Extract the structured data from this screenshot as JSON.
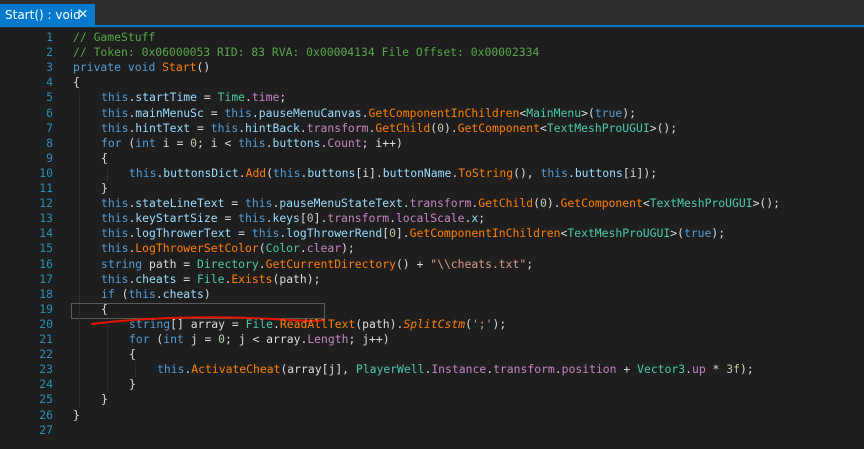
{
  "tab": {
    "title": "Start() : void",
    "close_label": "✕"
  },
  "colors": {
    "accent": "#007acc",
    "background": "#1e1e1e",
    "line_number": "#2b91af",
    "keyword": "#569cd6",
    "type": "#4ec9b0",
    "method": "#ff8000",
    "comment": "#57a64a",
    "string": "#d69d85",
    "underline_mark": "#e51400"
  },
  "code_lines": [
    {
      "n": "1",
      "indent": 0,
      "tokens": [
        [
          "// GameStuff",
          "comment"
        ]
      ]
    },
    {
      "n": "2",
      "indent": 0,
      "tokens": [
        [
          "// Token: 0x06000053 RID: 83 RVA: 0x00004134 File Offset: 0x00002334",
          "comment"
        ]
      ]
    },
    {
      "n": "3",
      "indent": 0,
      "tokens": [
        [
          "private",
          "kw"
        ],
        [
          " ",
          "plain"
        ],
        [
          "void",
          "kw"
        ],
        [
          " ",
          "plain"
        ],
        [
          "Start",
          "method"
        ],
        [
          "()",
          "plain"
        ]
      ]
    },
    {
      "n": "4",
      "indent": 0,
      "tokens": [
        [
          "{",
          "plain"
        ]
      ]
    },
    {
      "n": "5",
      "indent": 1,
      "tokens": [
        [
          "this",
          "kw"
        ],
        [
          ".",
          "plain"
        ],
        [
          "startTime",
          "field"
        ],
        [
          " = ",
          "plain"
        ],
        [
          "Time",
          "type"
        ],
        [
          ".",
          "plain"
        ],
        [
          "time",
          "prop"
        ],
        [
          ";",
          "plain"
        ]
      ]
    },
    {
      "n": "6",
      "indent": 1,
      "tokens": [
        [
          "this",
          "kw"
        ],
        [
          ".",
          "plain"
        ],
        [
          "mainMenuSc",
          "field"
        ],
        [
          " = ",
          "plain"
        ],
        [
          "this",
          "kw"
        ],
        [
          ".",
          "plain"
        ],
        [
          "pauseMenuCanvas",
          "field"
        ],
        [
          ".",
          "plain"
        ],
        [
          "GetComponentInChildren",
          "method"
        ],
        [
          "<",
          "plain"
        ],
        [
          "MainMenu",
          "type"
        ],
        [
          ">(",
          "plain"
        ],
        [
          "true",
          "kw"
        ],
        [
          ");",
          "plain"
        ]
      ]
    },
    {
      "n": "7",
      "indent": 1,
      "tokens": [
        [
          "this",
          "kw"
        ],
        [
          ".",
          "plain"
        ],
        [
          "hintText",
          "field"
        ],
        [
          " = ",
          "plain"
        ],
        [
          "this",
          "kw"
        ],
        [
          ".",
          "plain"
        ],
        [
          "hintBack",
          "field"
        ],
        [
          ".",
          "plain"
        ],
        [
          "transform",
          "prop"
        ],
        [
          ".",
          "plain"
        ],
        [
          "GetChild",
          "method"
        ],
        [
          "(",
          "plain"
        ],
        [
          "0",
          "num"
        ],
        [
          ").",
          "plain"
        ],
        [
          "GetComponent",
          "method"
        ],
        [
          "<",
          "plain"
        ],
        [
          "TextMeshProUGUI",
          "type"
        ],
        [
          ">();",
          "plain"
        ]
      ]
    },
    {
      "n": "8",
      "indent": 1,
      "tokens": [
        [
          "for",
          "kw"
        ],
        [
          " (",
          "plain"
        ],
        [
          "int",
          "kw"
        ],
        [
          " i = ",
          "plain"
        ],
        [
          "0",
          "num"
        ],
        [
          "; i < ",
          "plain"
        ],
        [
          "this",
          "kw"
        ],
        [
          ".",
          "plain"
        ],
        [
          "buttons",
          "field"
        ],
        [
          ".",
          "plain"
        ],
        [
          "Count",
          "prop"
        ],
        [
          "; i++)",
          "plain"
        ]
      ]
    },
    {
      "n": "9",
      "indent": 1,
      "tokens": [
        [
          "{",
          "plain"
        ]
      ]
    },
    {
      "n": "10",
      "indent": 2,
      "tokens": [
        [
          "this",
          "kw"
        ],
        [
          ".",
          "plain"
        ],
        [
          "buttonsDict",
          "field"
        ],
        [
          ".",
          "plain"
        ],
        [
          "Add",
          "method"
        ],
        [
          "(",
          "plain"
        ],
        [
          "this",
          "kw"
        ],
        [
          ".",
          "plain"
        ],
        [
          "buttons",
          "field"
        ],
        [
          "[i].",
          "plain"
        ],
        [
          "buttonName",
          "field"
        ],
        [
          ".",
          "plain"
        ],
        [
          "ToString",
          "method"
        ],
        [
          "(), ",
          "plain"
        ],
        [
          "this",
          "kw"
        ],
        [
          ".",
          "plain"
        ],
        [
          "buttons",
          "field"
        ],
        [
          "[i]);",
          "plain"
        ]
      ]
    },
    {
      "n": "11",
      "indent": 1,
      "tokens": [
        [
          "}",
          "plain"
        ]
      ]
    },
    {
      "n": "12",
      "indent": 1,
      "tokens": [
        [
          "this",
          "kw"
        ],
        [
          ".",
          "plain"
        ],
        [
          "stateLineText",
          "field"
        ],
        [
          " = ",
          "plain"
        ],
        [
          "this",
          "kw"
        ],
        [
          ".",
          "plain"
        ],
        [
          "pauseMenuStateText",
          "field"
        ],
        [
          ".",
          "plain"
        ],
        [
          "transform",
          "prop"
        ],
        [
          ".",
          "plain"
        ],
        [
          "GetChild",
          "method"
        ],
        [
          "(",
          "plain"
        ],
        [
          "0",
          "num"
        ],
        [
          ").",
          "plain"
        ],
        [
          "GetComponent",
          "method"
        ],
        [
          "<",
          "plain"
        ],
        [
          "TextMeshProUGUI",
          "type"
        ],
        [
          ">();",
          "plain"
        ]
      ]
    },
    {
      "n": "13",
      "indent": 1,
      "tokens": [
        [
          "this",
          "kw"
        ],
        [
          ".",
          "plain"
        ],
        [
          "keyStartSize",
          "field"
        ],
        [
          " = ",
          "plain"
        ],
        [
          "this",
          "kw"
        ],
        [
          ".",
          "plain"
        ],
        [
          "keys",
          "field"
        ],
        [
          "[",
          "plain"
        ],
        [
          "0",
          "num"
        ],
        [
          "].",
          "plain"
        ],
        [
          "transform",
          "prop"
        ],
        [
          ".",
          "plain"
        ],
        [
          "localScale",
          "prop"
        ],
        [
          ".",
          "plain"
        ],
        [
          "x",
          "field"
        ],
        [
          ";",
          "plain"
        ]
      ]
    },
    {
      "n": "14",
      "indent": 1,
      "tokens": [
        [
          "this",
          "kw"
        ],
        [
          ".",
          "plain"
        ],
        [
          "logThrowerText",
          "field"
        ],
        [
          " = ",
          "plain"
        ],
        [
          "this",
          "kw"
        ],
        [
          ".",
          "plain"
        ],
        [
          "logThrowerRend",
          "field"
        ],
        [
          "[",
          "plain"
        ],
        [
          "0",
          "num"
        ],
        [
          "].",
          "plain"
        ],
        [
          "GetComponentInChildren",
          "method"
        ],
        [
          "<",
          "plain"
        ],
        [
          "TextMeshProUGUI",
          "type"
        ],
        [
          ">(",
          "plain"
        ],
        [
          "true",
          "kw"
        ],
        [
          ");",
          "plain"
        ]
      ]
    },
    {
      "n": "15",
      "indent": 1,
      "tokens": [
        [
          "this",
          "kw"
        ],
        [
          ".",
          "plain"
        ],
        [
          "LogThrowerSetColor",
          "method"
        ],
        [
          "(",
          "plain"
        ],
        [
          "Color",
          "type"
        ],
        [
          ".",
          "plain"
        ],
        [
          "clear",
          "prop"
        ],
        [
          ");",
          "plain"
        ]
      ]
    },
    {
      "n": "16",
      "indent": 1,
      "tokens": [
        [
          "string",
          "kw"
        ],
        [
          " path = ",
          "plain"
        ],
        [
          "Directory",
          "type"
        ],
        [
          ".",
          "plain"
        ],
        [
          "GetCurrentDirectory",
          "method"
        ],
        [
          "() + ",
          "plain"
        ],
        [
          "\"\\\\cheats.txt\"",
          "str"
        ],
        [
          ";",
          "plain"
        ]
      ]
    },
    {
      "n": "17",
      "indent": 1,
      "tokens": [
        [
          "this",
          "kw"
        ],
        [
          ".",
          "plain"
        ],
        [
          "cheats",
          "field"
        ],
        [
          " = ",
          "plain"
        ],
        [
          "File",
          "type"
        ],
        [
          ".",
          "plain"
        ],
        [
          "Exists",
          "method"
        ],
        [
          "(path);",
          "plain"
        ]
      ]
    },
    {
      "n": "18",
      "indent": 1,
      "tokens": [
        [
          "if",
          "kw"
        ],
        [
          " (",
          "plain"
        ],
        [
          "this",
          "kw"
        ],
        [
          ".",
          "plain"
        ],
        [
          "cheats",
          "field"
        ],
        [
          ")",
          "plain"
        ]
      ]
    },
    {
      "n": "19",
      "indent": 1,
      "tokens": [
        [
          "{",
          "plain"
        ]
      ]
    },
    {
      "n": "20",
      "indent": 2,
      "tokens": [
        [
          "string",
          "kw"
        ],
        [
          "[] array = ",
          "plain"
        ],
        [
          "File",
          "type"
        ],
        [
          ".",
          "plain"
        ],
        [
          "ReadAllText",
          "method"
        ],
        [
          "(path).",
          "plain"
        ],
        [
          "SplitCstm",
          "ext"
        ],
        [
          "(",
          "plain"
        ],
        [
          "';'",
          "str"
        ],
        [
          ");",
          "plain"
        ]
      ]
    },
    {
      "n": "21",
      "indent": 2,
      "tokens": [
        [
          "for",
          "kw"
        ],
        [
          " (",
          "plain"
        ],
        [
          "int",
          "kw"
        ],
        [
          " j = ",
          "plain"
        ],
        [
          "0",
          "num"
        ],
        [
          "; j < array.",
          "plain"
        ],
        [
          "Length",
          "prop"
        ],
        [
          "; j++)",
          "plain"
        ]
      ]
    },
    {
      "n": "22",
      "indent": 2,
      "tokens": [
        [
          "{",
          "plain"
        ]
      ]
    },
    {
      "n": "23",
      "indent": 3,
      "tokens": [
        [
          "this",
          "kw"
        ],
        [
          ".",
          "plain"
        ],
        [
          "ActivateCheat",
          "method"
        ],
        [
          "(array[j], ",
          "plain"
        ],
        [
          "PlayerWell",
          "type"
        ],
        [
          ".",
          "plain"
        ],
        [
          "Instance",
          "prop"
        ],
        [
          ".",
          "plain"
        ],
        [
          "transform",
          "prop"
        ],
        [
          ".",
          "plain"
        ],
        [
          "position",
          "prop"
        ],
        [
          " + ",
          "plain"
        ],
        [
          "Vector3",
          "type"
        ],
        [
          ".",
          "plain"
        ],
        [
          "up",
          "prop"
        ],
        [
          " * ",
          "plain"
        ],
        [
          "3f",
          "num"
        ],
        [
          ");",
          "plain"
        ]
      ]
    },
    {
      "n": "24",
      "indent": 2,
      "tokens": [
        [
          "}",
          "plain"
        ]
      ]
    },
    {
      "n": "25",
      "indent": 1,
      "tokens": [
        [
          "}",
          "plain"
        ]
      ]
    },
    {
      "n": "26",
      "indent": 0,
      "tokens": [
        [
          "}",
          "plain"
        ]
      ]
    },
    {
      "n": "27",
      "indent": 0,
      "tokens": []
    }
  ]
}
